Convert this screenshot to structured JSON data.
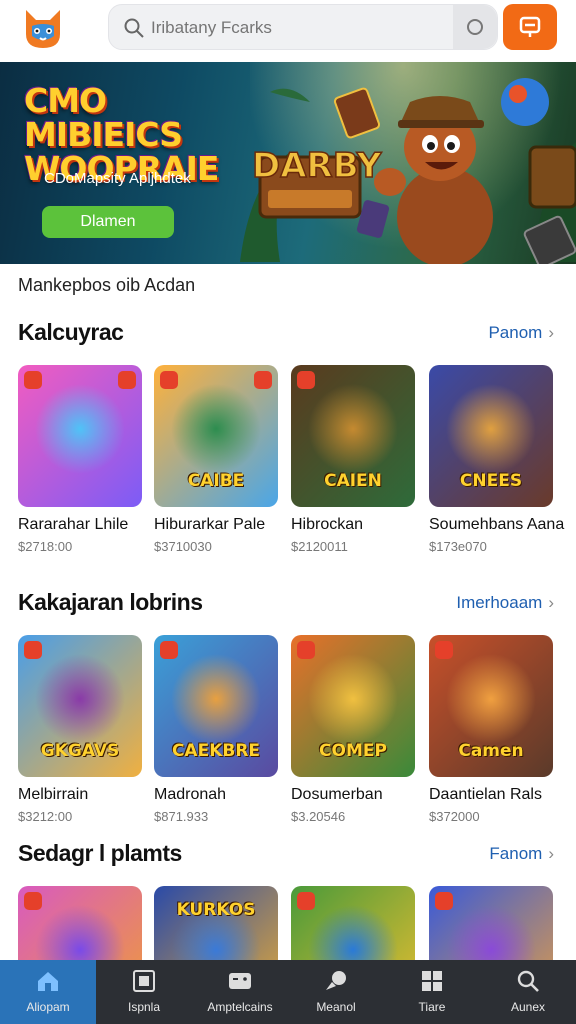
{
  "header": {
    "search_placeholder": "Iribatany Fcarks"
  },
  "banner": {
    "title": "CMO MIBIEICS WOOPRAIE",
    "subtitle": "CDoMapsity Apljhdtek",
    "button_label": "Dlamen"
  },
  "marketplace_label": "Mankepbos oib Acdan",
  "sections": [
    {
      "title": "Kalcuyrac",
      "link": "Panom",
      "cards": [
        {
          "name": "Rararahar Lhile",
          "price": "$2718:00",
          "thumb_label": "",
          "colors": [
            "#f25cc0",
            "#7c5cf6",
            "#4fc3f7"
          ]
        },
        {
          "name": "Hiburarkar Pale",
          "price": "$3710030",
          "thumb_label": "CAIBE",
          "colors": [
            "#ffb13b",
            "#4aa6e8",
            "#2d8d4f"
          ]
        },
        {
          "name": "Hibrockan",
          "price": "$2120011",
          "thumb_label": "CAIEN",
          "colors": [
            "#5a3a1e",
            "#2e6b3a",
            "#c58a30"
          ]
        },
        {
          "name": "Soumehbans Aana",
          "price": "$173e070",
          "thumb_label": "CNEES",
          "colors": [
            "#3a4aa8",
            "#6a3a2a",
            "#e0a040"
          ]
        }
      ]
    },
    {
      "title": "Kakajaran lobrins",
      "link": "Imerhoaam",
      "cards": [
        {
          "name": "Melbirrain",
          "price": "$3212:00",
          "thumb_label": "GKGAVS",
          "colors": [
            "#4a9ee8",
            "#f0b040",
            "#8a3aa8"
          ]
        },
        {
          "name": "Madronah",
          "price": "$871.933",
          "thumb_label": "CAEKBRE",
          "colors": [
            "#3aa0d8",
            "#5a4aa0",
            "#e8a040"
          ]
        },
        {
          "name": "Dosumerban",
          "price": "$3.20546",
          "thumb_label": "COMEP",
          "colors": [
            "#e8702a",
            "#3a8a3a",
            "#f0c040"
          ]
        },
        {
          "name": "Daantielan Rals",
          "price": "$372000",
          "thumb_label": "Camen",
          "colors": [
            "#c8502a",
            "#5a3a2a",
            "#f0a040"
          ]
        }
      ]
    },
    {
      "title": "Sedagr l plamts",
      "link": "Fanom",
      "cards": [
        {
          "name": "",
          "price": "",
          "thumb_label": "",
          "colors": [
            "#d85ac0",
            "#f0a030",
            "#7a4ae8"
          ]
        },
        {
          "name": "",
          "price": "",
          "thumb_label": "KURKOS",
          "colors": [
            "#2a4aa8",
            "#f0b030",
            "#3a7ad8"
          ]
        },
        {
          "name": "",
          "price": "",
          "thumb_label": "",
          "colors": [
            "#4a9a3a",
            "#f0c030",
            "#2a7ad8"
          ]
        },
        {
          "name": "",
          "price": "",
          "thumb_label": "",
          "colors": [
            "#3a5ad8",
            "#e8a040",
            "#8a4ad8"
          ]
        }
      ]
    }
  ],
  "bottom_nav": [
    {
      "label": "Aliopam",
      "icon": "home-icon"
    },
    {
      "label": "Ispnla",
      "icon": "library-icon"
    },
    {
      "label": "Amptelcains",
      "icon": "controller-icon"
    },
    {
      "label": "Meanol",
      "icon": "chat-icon"
    },
    {
      "label": "Tiare",
      "icon": "grid-icon"
    },
    {
      "label": "Aunex",
      "icon": "search-icon"
    }
  ]
}
